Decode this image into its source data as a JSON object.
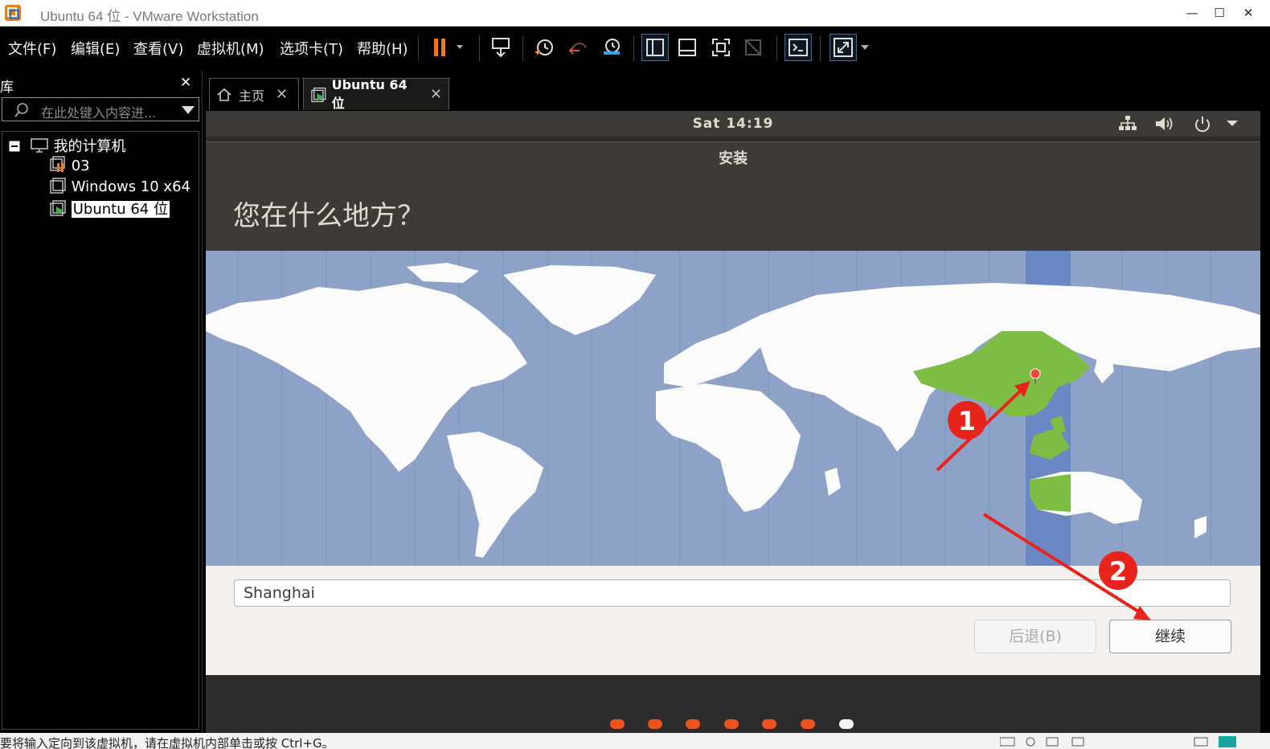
{
  "window": {
    "title": "Ubuntu 64 位 - VMware Workstation",
    "controls": [
      "minimize",
      "maximize",
      "close"
    ]
  },
  "menu": [
    "文件(F)",
    "编辑(E)",
    "查看(V)",
    "虚拟机(M)",
    "选项卡(T)",
    "帮助(H)"
  ],
  "toolbar": {
    "buttons": [
      "pause-icon",
      "send-ctrl-alt-del-icon",
      "snapshot-icon",
      "revert-snapshot-icon",
      "snapshot-manager-icon",
      "show-library-icon",
      "thumbnail-icon",
      "fit-guest-icon",
      "unity-icon",
      "console-icon",
      "fullscreen-icon"
    ]
  },
  "library": {
    "title": "库",
    "search_placeholder": "在此处键入内容进...",
    "root": "我的计算机",
    "items": [
      "03",
      "Windows 10 x64",
      "Ubuntu 64 位"
    ],
    "selected": "Ubuntu 64 位"
  },
  "tabs": [
    {
      "label": "主页",
      "icon": "home-icon"
    },
    {
      "label": "Ubuntu 64 位",
      "icon": "vm-icon",
      "active": true
    }
  ],
  "guest": {
    "clock": "Sat 14:19",
    "tray_icons": [
      "network-icon",
      "volume-icon",
      "power-icon",
      "dropdown-icon"
    ],
    "installer": {
      "title": "安装",
      "question": "您在什么地方？",
      "timezone_value": "Shanghai",
      "back_label": "后退(B)",
      "continue_label": "继续"
    },
    "progress_dots": {
      "total": 7,
      "current": 7
    }
  },
  "annotations": [
    "1",
    "2"
  ],
  "status": {
    "text": "要将输入定向到该虚拟机，请在虚拟机内部单击或按 Ctrl+G。"
  },
  "colors": {
    "ubuntu_orange": "#e95420",
    "map_ocean": "#8ea2c7",
    "map_selected": "#7dbd44",
    "annotation_red": "#e8231b"
  }
}
